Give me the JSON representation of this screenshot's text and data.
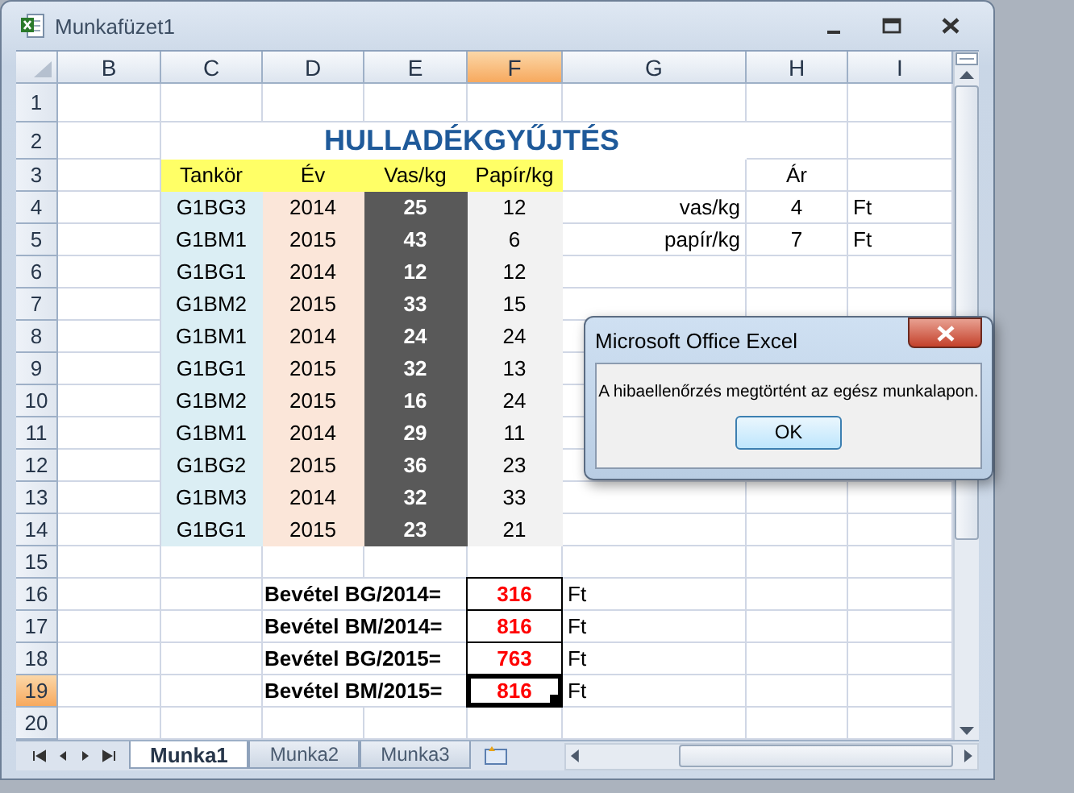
{
  "window": {
    "title": "Munkafüzet1"
  },
  "columns": [
    {
      "label": "B",
      "selected": false
    },
    {
      "label": "C",
      "selected": false
    },
    {
      "label": "D",
      "selected": false
    },
    {
      "label": "E",
      "selected": false
    },
    {
      "label": "F",
      "selected": true
    },
    {
      "label": "G",
      "selected": false
    },
    {
      "label": "H",
      "selected": false
    },
    {
      "label": "I",
      "selected": false
    }
  ],
  "row_headers": [
    {
      "label": "1",
      "selected": false
    },
    {
      "label": "2",
      "selected": false
    },
    {
      "label": "3",
      "selected": false
    },
    {
      "label": "4",
      "selected": false
    },
    {
      "label": "5",
      "selected": false
    },
    {
      "label": "6",
      "selected": false
    },
    {
      "label": "7",
      "selected": false
    },
    {
      "label": "8",
      "selected": false
    },
    {
      "label": "9",
      "selected": false
    },
    {
      "label": "10",
      "selected": false
    },
    {
      "label": "11",
      "selected": false
    },
    {
      "label": "12",
      "selected": false
    },
    {
      "label": "13",
      "selected": false
    },
    {
      "label": "14",
      "selected": false
    },
    {
      "label": "15",
      "selected": false
    },
    {
      "label": "16",
      "selected": false
    },
    {
      "label": "17",
      "selected": false
    },
    {
      "label": "18",
      "selected": false
    },
    {
      "label": "19",
      "selected": true
    },
    {
      "label": "20",
      "selected": false
    }
  ],
  "title": "HULLADÉKGYŰJTÉS",
  "data_table": {
    "headers": [
      "Tankör",
      "Év",
      "Vas/kg",
      "Papír/kg"
    ],
    "rows": [
      [
        "G1BG3",
        "2014",
        "25",
        "12"
      ],
      [
        "G1BM1",
        "2015",
        "43",
        "6"
      ],
      [
        "G1BG1",
        "2014",
        "12",
        "12"
      ],
      [
        "G1BM2",
        "2015",
        "33",
        "15"
      ],
      [
        "G1BM1",
        "2014",
        "24",
        "24"
      ],
      [
        "G1BG1",
        "2015",
        "32",
        "13"
      ],
      [
        "G1BM2",
        "2015",
        "16",
        "24"
      ],
      [
        "G1BM1",
        "2014",
        "29",
        "11"
      ],
      [
        "G1BG2",
        "2015",
        "36",
        "23"
      ],
      [
        "G1BM3",
        "2014",
        "32",
        "33"
      ],
      [
        "G1BG1",
        "2015",
        "23",
        "21"
      ]
    ]
  },
  "price_table": {
    "heading": "Ár",
    "rows": [
      {
        "label": "vas/kg",
        "value": "4",
        "unit": "Ft"
      },
      {
        "label": "papír/kg",
        "value": "7",
        "unit": "Ft"
      }
    ]
  },
  "revenue": [
    {
      "label": "Bevétel BG/2014=",
      "value": "316",
      "unit": "Ft"
    },
    {
      "label": "Bevétel BM/2014=",
      "value": "816",
      "unit": "Ft"
    },
    {
      "label": "Bevétel BG/2015=",
      "value": "763",
      "unit": "Ft"
    },
    {
      "label": "Bevétel BM/2015=",
      "value": "816",
      "unit": "Ft"
    }
  ],
  "sheet_tabs": [
    {
      "label": "Munka1",
      "selected": true
    },
    {
      "label": "Munka2",
      "selected": false
    },
    {
      "label": "Munka3",
      "selected": false
    }
  ],
  "dialog": {
    "title": "Microsoft Office Excel",
    "message": "A hibaellenőrzés megtörtént az egész munkalapon.",
    "button": "OK"
  }
}
